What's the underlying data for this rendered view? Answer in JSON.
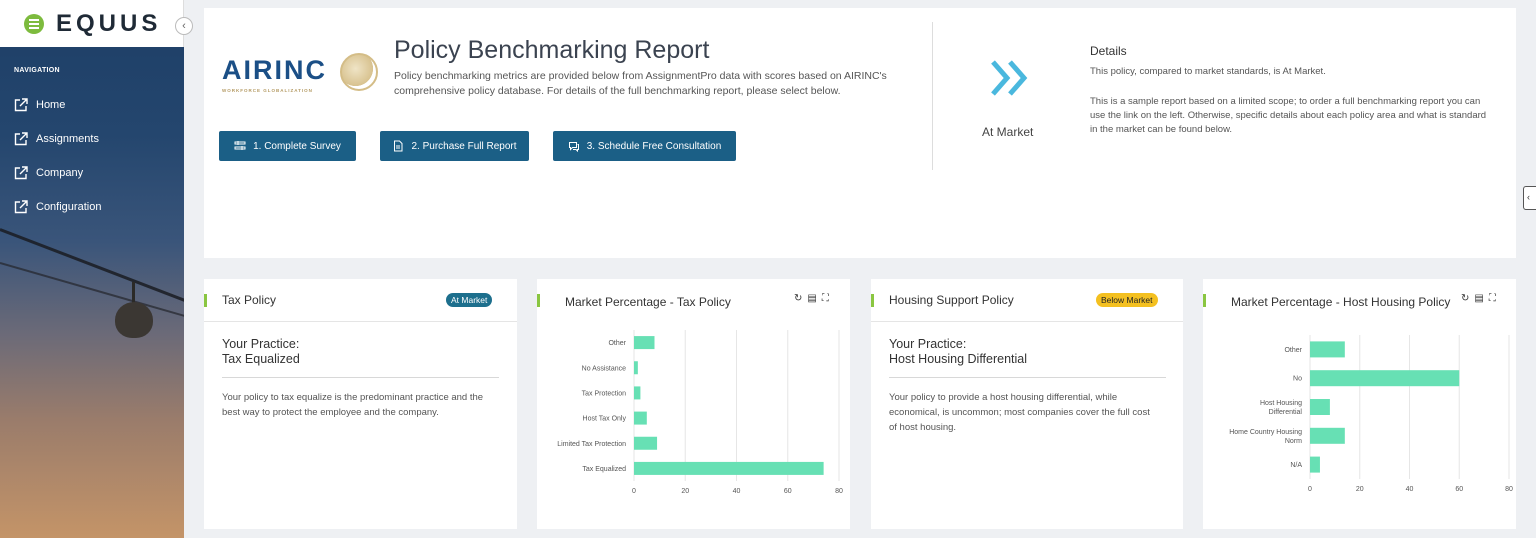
{
  "brand": {
    "name": "EQUUS"
  },
  "sidebar": {
    "section_title": "NAVIGATION",
    "items": [
      {
        "label": "Home",
        "icon": "external-link-icon"
      },
      {
        "label": "Assignments",
        "icon": "external-link-icon"
      },
      {
        "label": "Company",
        "icon": "external-link-icon"
      },
      {
        "label": "Configuration",
        "icon": "external-link-icon"
      }
    ],
    "collapse_glyph": "‹"
  },
  "header": {
    "logo_text": "AIRINC",
    "logo_tagline": "WORKFORCE GLOBALIZATION",
    "title": "Policy Benchmarking Report",
    "description": "Policy benchmarking metrics are provided below from AssignmentPro data with scores based on AIRINC's comprehensive policy database. For details of the full benchmarking report, please select below.",
    "buttons": [
      {
        "label": "1. Complete Survey",
        "icon": "survey-icon"
      },
      {
        "label": "2. Purchase Full Report",
        "icon": "document-icon"
      },
      {
        "label": "3. Schedule Free Consultation",
        "icon": "chat-icon"
      }
    ],
    "status_label": "At Market",
    "details_title": "Details",
    "details_line1": "This policy, compared to market standards, is At Market.",
    "details_line2": "This is a sample report based on a limited scope; to order a full benchmarking report you can use the link on the left. Otherwise, specific details about each policy area and what is standard in the market can be found below.",
    "accent_color": "#4ab8de"
  },
  "tax_policy": {
    "title": "Tax Policy",
    "badge": "At Market",
    "practice_label": "Your Practice:",
    "practice_value": "Tax Equalized",
    "description": "Your policy to tax equalize is the predominant practice and the best way to protect the employee and the company."
  },
  "housing_policy": {
    "title": "Housing Support Policy",
    "badge": "Below Market",
    "practice_label": "Your Practice:",
    "practice_value": "Host Housing Differential",
    "description": "Your policy to provide a host housing differential, while economical, is uncommon; most companies cover the full cost of host housing."
  },
  "chart_icons": [
    "refresh-icon",
    "export-icon",
    "fullscreen-icon"
  ],
  "chart_data": [
    {
      "type": "bar",
      "orientation": "horizontal",
      "title": "Market Percentage - Tax Policy",
      "categories": [
        "Other",
        "No Assistance",
        "Tax Protection",
        "Host Tax Only",
        "Limited Tax Protection",
        "Tax Equalized"
      ],
      "values": [
        8,
        1.5,
        2.5,
        5,
        9,
        74
      ],
      "xlim": [
        0,
        80
      ],
      "xticks": [
        0,
        20,
        40,
        60,
        80
      ],
      "grid": true,
      "color": "#67e0b4"
    },
    {
      "type": "bar",
      "orientation": "horizontal",
      "title": "Market Percentage - Host Housing Policy",
      "categories": [
        "Other",
        "No",
        "Host Housing Differential",
        "Home Country Housing Norm",
        "N/A"
      ],
      "values": [
        14,
        60,
        8,
        14,
        4
      ],
      "xlim": [
        0,
        80
      ],
      "xticks": [
        0,
        20,
        40,
        60,
        80
      ],
      "grid": true,
      "color": "#67e0b4"
    }
  ]
}
